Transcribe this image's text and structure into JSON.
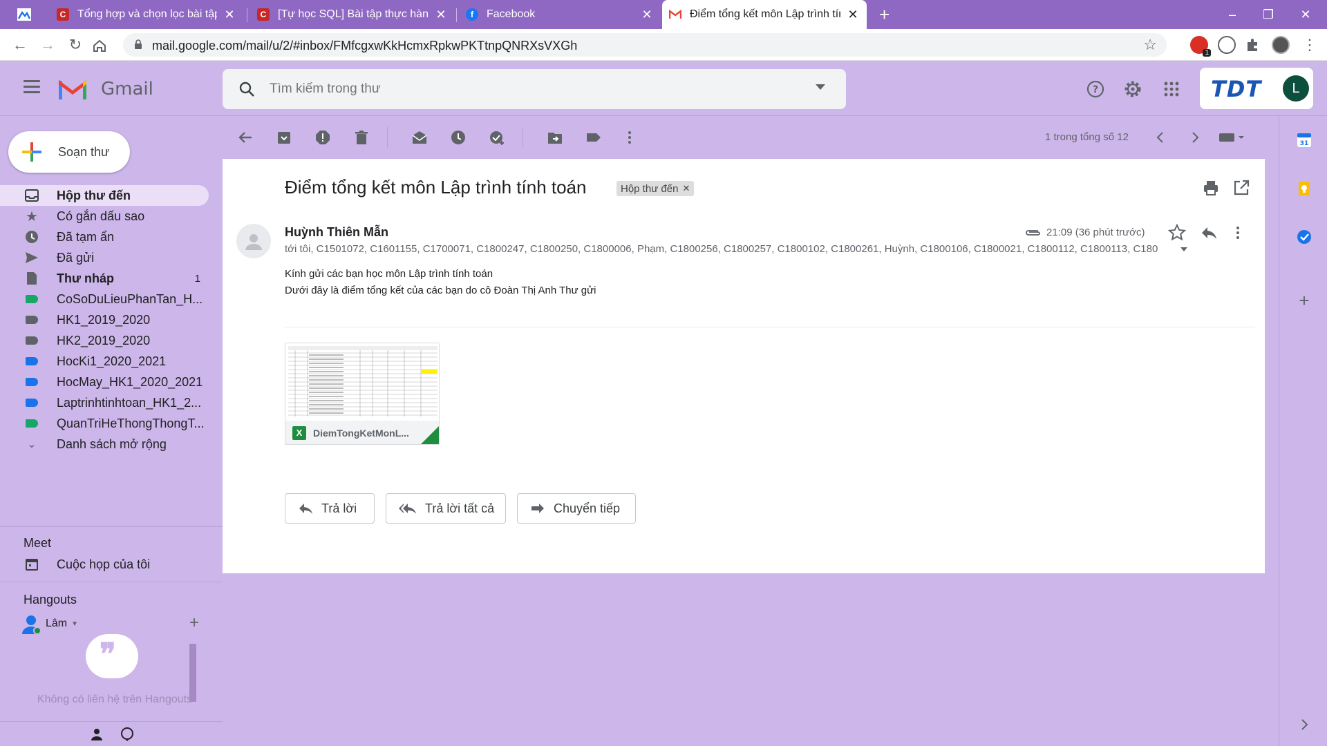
{
  "browser": {
    "tabs": [
      {
        "title": "Tổng hợp và chọn lọc bài tập SQL",
        "active": false
      },
      {
        "title": "[Tự học SQL] Bài tập thực hành cơ bản",
        "active": false
      },
      {
        "title": "Facebook",
        "active": false
      },
      {
        "title": "Điểm tổng kết môn Lập trình tính toán",
        "active": true
      }
    ],
    "new_tab": "+",
    "url": "mail.google.com/mail/u/2/#inbox/FMfcgxwKkHcmxRpkwPKTtnpQNRXsVXGh",
    "extension_badge": "1",
    "minimize": "–",
    "restore": "❐",
    "close": "✕"
  },
  "gmail": {
    "product": "Gmail",
    "search_placeholder": "Tìm kiếm trong thư",
    "avatar_letter": "L",
    "org_logo_text": "TDT"
  },
  "sidebar": {
    "compose": "Soạn thư",
    "items": [
      {
        "label": "Hộp thư đến",
        "icon": "inbox-icon",
        "active": true
      },
      {
        "label": "Có gắn dấu sao",
        "icon": "star-icon"
      },
      {
        "label": "Đã tạm ẩn",
        "icon": "clock-icon"
      },
      {
        "label": "Đã gửi",
        "icon": "send-icon"
      },
      {
        "label": "Thư nháp",
        "icon": "draft-icon",
        "count": "1",
        "bold": true
      },
      {
        "label": "CoSoDuLieuPhanTan_H...",
        "icon": "label-icon",
        "color": "#16a765"
      },
      {
        "label": "HK1_2019_2020",
        "icon": "label-icon",
        "color": "#5f6368"
      },
      {
        "label": "HK2_2019_2020",
        "icon": "label-icon",
        "color": "#5f6368"
      },
      {
        "label": "HocKi1_2020_2021",
        "icon": "label-icon",
        "color": "#1a73e8"
      },
      {
        "label": "HocMay_HK1_2020_2021",
        "icon": "label-icon",
        "color": "#1a73e8"
      },
      {
        "label": "Laptrinhtinhtoan_HK1_2...",
        "icon": "label-icon",
        "color": "#1a73e8"
      },
      {
        "label": "QuanTriHeThongThongT...",
        "icon": "label-icon",
        "color": "#16a765"
      },
      {
        "label": "Danh sách mở rộng",
        "icon": "chevron-down-icon"
      }
    ],
    "meet_title": "Meet",
    "meet_item": "Cuộc họp của tôi",
    "hangouts_title": "Hangouts",
    "hangouts_user": "Lâm",
    "hangouts_empty": "Không có liên hệ trên Hangouts"
  },
  "toolbar": {
    "pager": "1 trong tổng số 12"
  },
  "message": {
    "subject": "Điểm tổng kết môn Lập trình tính toán",
    "label_chip": "Hộp thư đến",
    "sender": "Huỳnh Thiên Mẫn",
    "recipients": "tới tôi, C1501072, C1601155, C1700071, C1800247, C1800250, C1800006, Phạm, C1800256, C1800257, C1800102, C1800261, Huỳnh, C1800106, C1800021, C1800112, C1800113, C180",
    "time": "21:09 (36 phút trước)",
    "body_line1": "Kính gửi các bạn học môn Lập trình tính toán",
    "body_line2": "Dưới đây là điểm tổng kết của các bạn do cô Đoàn Thị Anh Thư gửi",
    "attachment_name": "DiemTongKetMonL...",
    "attachment_type": "X",
    "reply": "Trả lời",
    "reply_all": "Trả lời tất cả",
    "forward": "Chuyển tiếp"
  },
  "colors": {
    "theme_purple": "#cdb6ea",
    "tabbar": "#8e68c3",
    "excel_green": "#1e8e3e"
  }
}
